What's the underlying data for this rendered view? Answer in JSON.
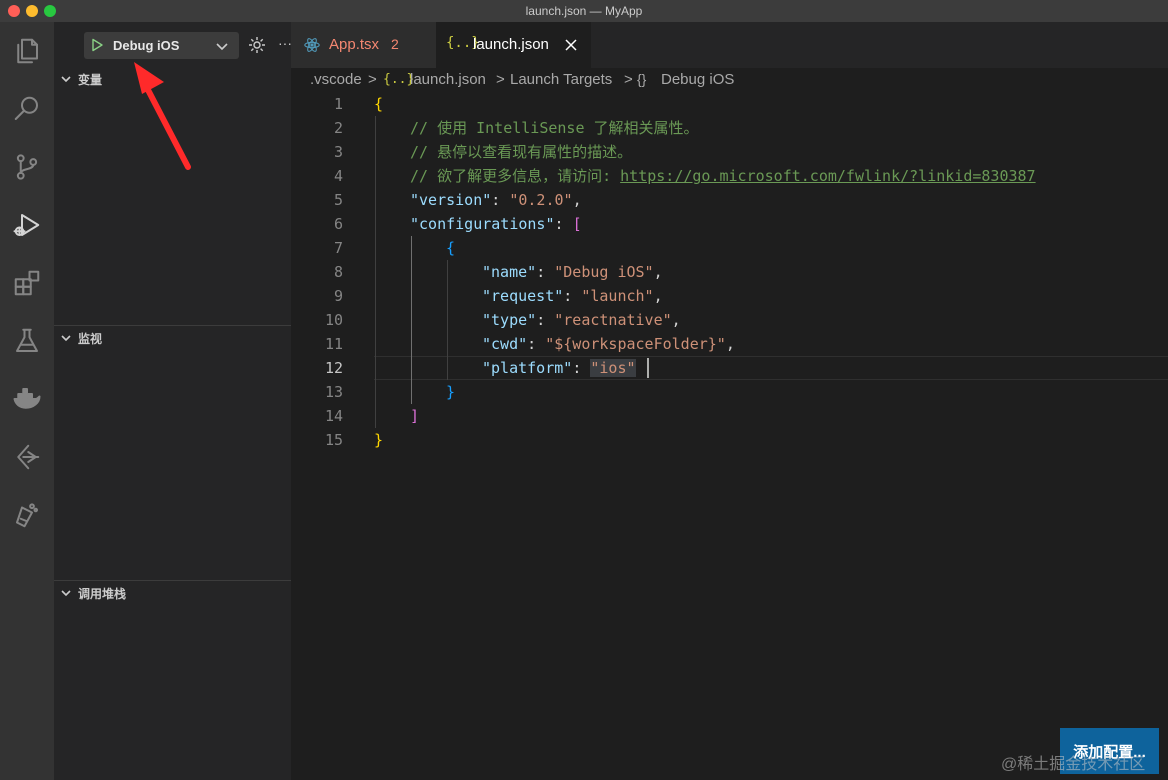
{
  "window": {
    "title": "launch.json — MyApp"
  },
  "activity_bar": {
    "items": [
      {
        "icon": "files-icon",
        "active": false
      },
      {
        "icon": "search-icon",
        "active": false
      },
      {
        "icon": "source-control-icon",
        "active": false
      },
      {
        "icon": "run-debug-icon",
        "active": true
      },
      {
        "icon": "extensions-icon",
        "active": false
      },
      {
        "icon": "testing-icon",
        "active": false
      },
      {
        "icon": "docker-icon",
        "active": false
      },
      {
        "icon": "remote-explorer-icon",
        "active": false
      },
      {
        "icon": "flask-icon",
        "active": false
      }
    ]
  },
  "debug_toolbar": {
    "config_label": "Debug iOS",
    "more_label": "···"
  },
  "sidebar": {
    "sections": [
      {
        "label": "变量"
      },
      {
        "label": "监视"
      },
      {
        "label": "调用堆栈"
      }
    ]
  },
  "tabs": [
    {
      "label": "App.tsx",
      "problems": "2",
      "icon": "react-icon",
      "active": false
    },
    {
      "label": "launch.json",
      "icon": "json-braces-icon",
      "active": true
    }
  ],
  "breadcrumb": {
    "items": [
      ".vscode",
      "launch.json",
      "Launch Targets",
      "Debug iOS"
    ],
    "separator": ">",
    "file_icon": "{..}",
    "object_icon": "{}"
  },
  "editor": {
    "current_line": 12,
    "lines": [
      {
        "n": "1",
        "text": "{"
      },
      {
        "n": "2",
        "text": "// 使用 IntelliSense 了解相关属性。"
      },
      {
        "n": "3",
        "text": "// 悬停以查看现有属性的描述。"
      },
      {
        "n": "4",
        "text": "// 欲了解更多信息，请访问: ",
        "link": "https://go.microsoft.com/fwlink/?linkid=830387"
      },
      {
        "n": "5",
        "key": "\"version\"",
        "value": "\"0.2.0\"",
        "tail": ","
      },
      {
        "n": "6",
        "key": "\"configurations\"",
        "tail": "["
      },
      {
        "n": "7",
        "text": "{"
      },
      {
        "n": "8",
        "key": "\"name\"",
        "value": "\"Debug iOS\"",
        "tail": ","
      },
      {
        "n": "9",
        "key": "\"request\"",
        "value": "\"launch\"",
        "tail": ","
      },
      {
        "n": "10",
        "key": "\"type\"",
        "value": "\"reactnative\"",
        "tail": ","
      },
      {
        "n": "11",
        "key": "\"cwd\"",
        "value": "\"${workspaceFolder}\"",
        "tail": ","
      },
      {
        "n": "12",
        "key": "\"platform\"",
        "value": "\"ios\""
      },
      {
        "n": "13",
        "text": "}"
      },
      {
        "n": "14",
        "text": "]"
      },
      {
        "n": "15",
        "text": "}"
      }
    ]
  },
  "add_config_button": {
    "label": "添加配置..."
  },
  "watermark": {
    "text": "@稀土掘金技术社区"
  },
  "colors": {
    "accent": "#0e639c",
    "annotation_arrow": "#ff2a2a",
    "play_green": "#89d185"
  }
}
